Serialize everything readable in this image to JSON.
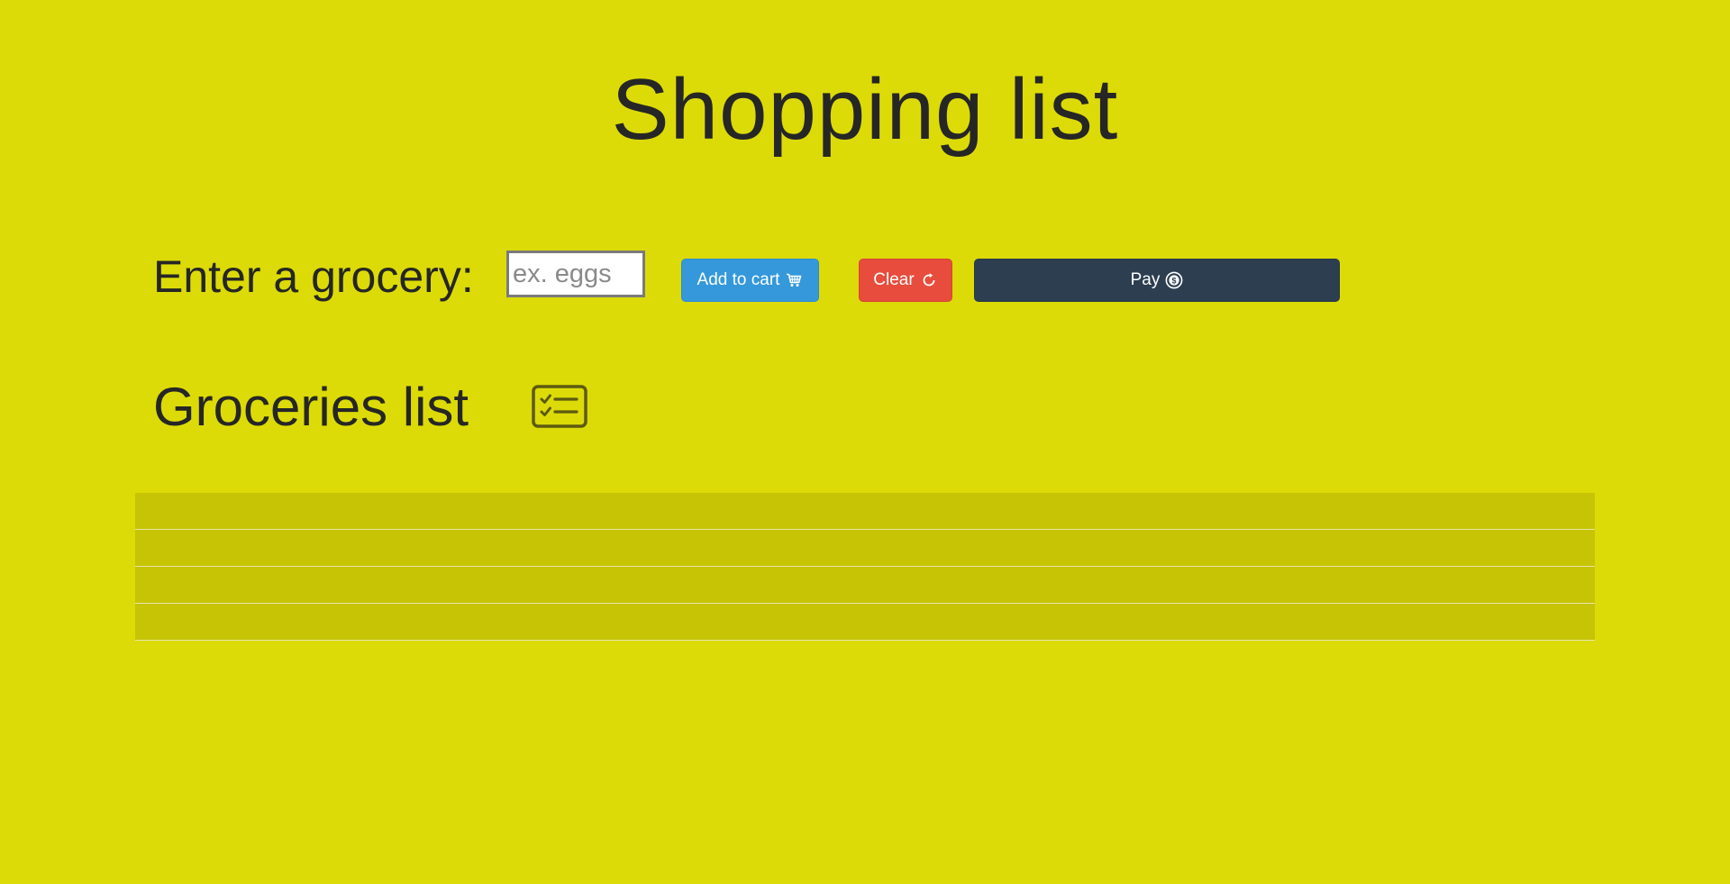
{
  "header": {
    "title": "Shopping list"
  },
  "entry": {
    "label": "Enter a grocery:",
    "input_value": "",
    "input_placeholder": "ex. eggs"
  },
  "actions": {
    "add_label": "Add to cart",
    "add_icon": "cart-icon",
    "clear_label": "Clear",
    "clear_icon": "refresh-icon",
    "pay_label": "Pay",
    "pay_icon": "dollar-coin-icon"
  },
  "list": {
    "title": "Groceries list",
    "icon": "checklist-icon",
    "rows": [
      "",
      "",
      "",
      ""
    ]
  },
  "colors": {
    "background": "#dcdb07",
    "row": "#c6c405",
    "add_button": "#3498db",
    "clear_button": "#e74c3c",
    "pay_button": "#2c3e50"
  }
}
